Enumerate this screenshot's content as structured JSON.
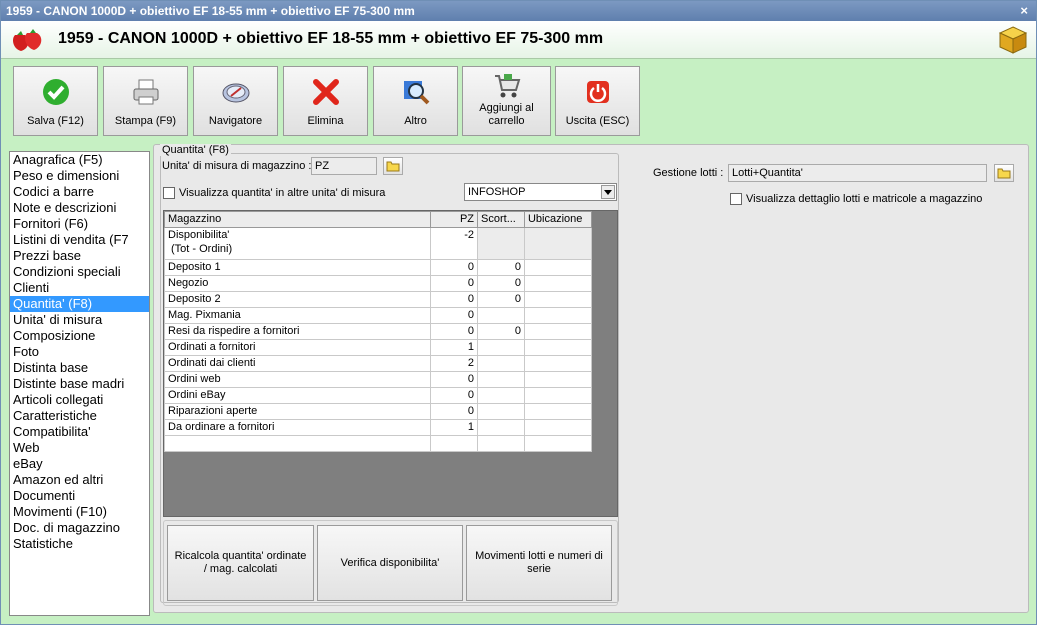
{
  "window_title": "1959 - CANON 1000D + obiettivo EF 18-55 mm + obiettivo EF 75-300 mm",
  "header_title": "1959 - CANON 1000D + obiettivo EF 18-55 mm + obiettivo EF 75-300 mm",
  "close_glyph": "×",
  "toolbar": [
    {
      "name": "salva-button",
      "label": "Salva (F12)",
      "icon": "check-icon"
    },
    {
      "name": "stampa-button",
      "label": "Stampa (F9)",
      "icon": "printer-icon"
    },
    {
      "name": "navigatore-button",
      "label": "Navigatore",
      "icon": "compass-icon"
    },
    {
      "name": "elimina-button",
      "label": "Elimina",
      "icon": "delete-x-icon"
    },
    {
      "name": "altro-button",
      "label": "Altro",
      "icon": "magnifier-icon"
    },
    {
      "name": "aggiungi-carrello-button",
      "label": "Aggiungi al carrello",
      "icon": "cart-icon"
    },
    {
      "name": "uscita-button",
      "label": "Uscita (ESC)",
      "icon": "power-icon"
    }
  ],
  "sidebar": {
    "items": [
      "Anagrafica (F5)",
      "Peso e dimensioni",
      "Codici a barre",
      "Note e descrizioni",
      "Fornitori (F6)",
      "Listini di vendita (F7",
      "Prezzi base",
      "Condizioni speciali",
      "Clienti",
      "Quantita' (F8)",
      "Unita' di misura",
      "Composizione",
      "Foto",
      "Distinta base",
      "Distinte base madri",
      "Articoli collegati",
      "Caratteristiche",
      "Compatibilita'",
      "Web",
      "eBay",
      "Amazon ed altri",
      "Documenti",
      "Movimenti (F10)",
      "Doc. di magazzino",
      "Statistiche"
    ],
    "selected": 9
  },
  "quantity": {
    "group_title": "Quantita' (F8)",
    "unit_label": "Unita' di misura di magazzino :",
    "unit_value": "PZ",
    "show_other_units_label": "Visualizza quantita' in altre unita' di misura",
    "warehouse_combo": "INFOSHOP",
    "lots_label": "Gestione lotti :",
    "lots_value": "Lotti+Quantita'",
    "lots_detail_label": "Visualizza dettaglio lotti e matricole a magazzino",
    "columns": [
      "Magazzino",
      "PZ",
      "Scort...",
      "Ubicazione"
    ],
    "rows": [
      {
        "name": "Disponibilita'",
        "sub": "(Tot - Ordini)",
        "pz": "-2",
        "scorta": "",
        "ubic": ""
      },
      {
        "name": "Deposito 1",
        "sub": "",
        "pz": "0",
        "scorta": "0",
        "ubic": ""
      },
      {
        "name": "Negozio",
        "sub": "",
        "pz": "0",
        "scorta": "0",
        "ubic": ""
      },
      {
        "name": "Deposito 2",
        "sub": "",
        "pz": "0",
        "scorta": "0",
        "ubic": ""
      },
      {
        "name": "Mag. Pixmania",
        "sub": "",
        "pz": "0",
        "scorta": "",
        "ubic": ""
      },
      {
        "name": "Resi da rispedire a fornitori",
        "sub": "",
        "pz": "0",
        "scorta": "0",
        "ubic": ""
      },
      {
        "name": "Ordinati a fornitori",
        "sub": "",
        "pz": "1",
        "scorta": "",
        "ubic": ""
      },
      {
        "name": "Ordinati dai clienti",
        "sub": "",
        "pz": "2",
        "scorta": "",
        "ubic": ""
      },
      {
        "name": "Ordini web",
        "sub": "",
        "pz": "0",
        "scorta": "",
        "ubic": ""
      },
      {
        "name": "Ordini eBay",
        "sub": "",
        "pz": "0",
        "scorta": "",
        "ubic": ""
      },
      {
        "name": "Riparazioni aperte",
        "sub": "",
        "pz": "0",
        "scorta": "",
        "ubic": ""
      },
      {
        "name": "Da ordinare a fornitori",
        "sub": "",
        "pz": "1",
        "scorta": "",
        "ubic": ""
      },
      {
        "name": "",
        "sub": "",
        "pz": "",
        "scorta": "",
        "ubic": ""
      }
    ],
    "buttons": [
      "Ricalcola quantita' ordinate / mag. calcolati",
      "Verifica disponibilita'",
      "Movimenti lotti e numeri di serie"
    ]
  }
}
